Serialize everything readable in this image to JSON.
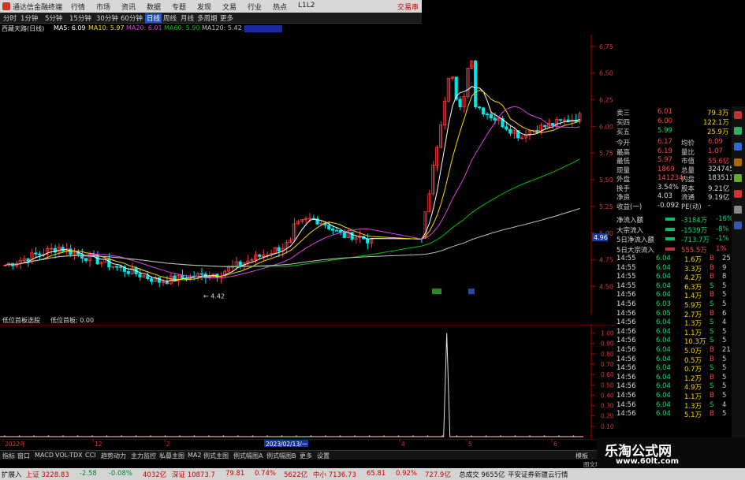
{
  "titlebar": {
    "app_title": "通达信金融终端",
    "menus": [
      "行情",
      "市场",
      "资讯",
      "数据",
      "专题",
      "发现",
      "文易",
      "行业",
      "热点",
      "L1L2"
    ],
    "trade_label": "交易串"
  },
  "timeframes": [
    "分时",
    "1分钟",
    "5分钟",
    "15分钟",
    "30分钟",
    "60分钟",
    "日线",
    "周线",
    "月线",
    "多周期",
    "更多"
  ],
  "ma_line": {
    "stock": "西藏天路(日线)",
    "ma5": "MA5: 6.09",
    "ma10": "MA10: 5.97",
    "ma20": "MA20: 6.01",
    "ma60": "MA60: 5.90",
    "ma120": "MA120: 5.42"
  },
  "indicator_header": {
    "name": "低位首板选股",
    "series": "低位首板: 0.00"
  },
  "chart_data": {
    "type": "line",
    "main_price_axis": [
      "6.75",
      "6.50",
      "6.25",
      "6.00",
      "5.75",
      "5.50",
      "5.25",
      "5.00",
      "4.75",
      "4.50"
    ],
    "current_price_tag": "4.96",
    "low_label": "4.42",
    "indicator_axis": [
      "1.00",
      "0.90",
      "0.80",
      "0.70",
      "0.60",
      "0.50",
      "0.40",
      "0.30",
      "0.20",
      "0.10"
    ],
    "indicator_series": {
      "name": "低位首板",
      "spike_value": 1.0
    },
    "x_labels": [
      "2022年",
      "12",
      "2",
      "4",
      "5",
      "6"
    ],
    "date_tag": "2023/02/13/一"
  },
  "quote_panel": {
    "order_book": [
      {
        "label": "卖三",
        "price": "6.01",
        "vol": "79.3万"
      },
      {
        "label": "买四",
        "price": "6.00",
        "vol": "122.1万"
      },
      {
        "label": "买五",
        "price": "5.99",
        "vol": "25.9万"
      }
    ],
    "stats": [
      {
        "a": "今开",
        "b": "6.17",
        "c": "均价",
        "d": "6.09"
      },
      {
        "a": "最高",
        "b": "6.19",
        "c": "量比",
        "d": "1.07"
      },
      {
        "a": "最低",
        "b": "5.97",
        "c": "市值",
        "d": "55.6亿"
      },
      {
        "a": "现量",
        "b": "1869",
        "c": "总量",
        "d": "324745"
      },
      {
        "a": "外盘",
        "b": "141234",
        "c": "内盘",
        "d": "183511"
      },
      {
        "a": "换手",
        "b": "3.54%",
        "c": "股本",
        "d": "9.21亿"
      },
      {
        "a": "净资",
        "b": "4.03",
        "c": "流通",
        "d": "9.19亿"
      },
      {
        "a": "收益(一)",
        "b": "-0.092",
        "c": "PE(动)",
        "d": "-"
      }
    ],
    "flows": [
      {
        "label": "净流入额",
        "val": "-3184万",
        "pct": "-16%"
      },
      {
        "label": "大宗流入",
        "val": "-1539万",
        "pct": "-8%"
      },
      {
        "label": "5日净流入额",
        "val": "-713.7万",
        "pct": "-1%"
      },
      {
        "label": "5日大宗流入",
        "val": "555.5万",
        "pct": "1%"
      }
    ],
    "ticks": [
      {
        "t": "14:55",
        "p": "6.04",
        "v": "1.6万",
        "d": "B",
        "n": "25"
      },
      {
        "t": "14:55",
        "p": "6.04",
        "v": "3.3万",
        "d": "B",
        "n": "9"
      },
      {
        "t": "14:55",
        "p": "6.04",
        "v": "4.2万",
        "d": "B",
        "n": "8"
      },
      {
        "t": "14:55",
        "p": "6.04",
        "v": "6.3万",
        "d": "S",
        "n": "5"
      },
      {
        "t": "14:56",
        "p": "6.04",
        "v": "1.4万",
        "d": "B",
        "n": "5"
      },
      {
        "t": "14:56",
        "p": "6.03",
        "v": "5.9万",
        "d": "S",
        "n": "5"
      },
      {
        "t": "14:56",
        "p": "6.05",
        "v": "2.7万",
        "d": "B",
        "n": "6"
      },
      {
        "t": "14:56",
        "p": "6.04",
        "v": "1.3万",
        "d": "S",
        "n": "4"
      },
      {
        "t": "14:56",
        "p": "6.04",
        "v": "1.1万",
        "d": "S",
        "n": "5"
      },
      {
        "t": "14:56",
        "p": "6.04",
        "v": "10.3万",
        "d": "S",
        "n": "5"
      },
      {
        "t": "14:56",
        "p": "6.04",
        "v": "5.0万",
        "d": "B",
        "n": "21"
      },
      {
        "t": "14:56",
        "p": "6.04",
        "v": "0.5万",
        "d": "B",
        "n": "5"
      },
      {
        "t": "14:56",
        "p": "6.04",
        "v": "0.7万",
        "d": "S",
        "n": "5"
      },
      {
        "t": "14:56",
        "p": "6.04",
        "v": "1.2万",
        "d": "B",
        "n": "5"
      },
      {
        "t": "14:56",
        "p": "6.04",
        "v": "4.9万",
        "d": "S",
        "n": "5"
      },
      {
        "t": "14:56",
        "p": "6.04",
        "v": "1.1万",
        "d": "B",
        "n": "5"
      },
      {
        "t": "14:56",
        "p": "6.04",
        "v": "1.3万",
        "d": "S",
        "n": "4"
      },
      {
        "t": "14:56",
        "p": "6.04",
        "v": "5.1万",
        "d": "B",
        "n": "5"
      }
    ]
  },
  "bottom_tabs": [
    "指标",
    "窗口",
    "MACD",
    "VOL-TDX",
    "CCI",
    "趋势动力",
    "主力监控",
    "私募主图",
    "MA2",
    "例式主图",
    "例式幅图A",
    "例式幅图B",
    "更多",
    "设置"
  ],
  "bottom_right_label": "模板",
  "bottom_right_small": "图文F10",
  "statusbar": {
    "items": [
      {
        "label": "扩展入",
        "val": ""
      },
      {
        "label": "上证",
        "val": "3228.83"
      },
      {
        "label": "",
        "val": "-2.58"
      },
      {
        "label": "",
        "val": "-0.08%"
      },
      {
        "label": "",
        "val": "4032亿"
      },
      {
        "label": "深证",
        "val": "10873.7"
      },
      {
        "label": "",
        "val": "79.81"
      },
      {
        "label": "",
        "val": "0.74%"
      },
      {
        "label": "",
        "val": "5622亿"
      },
      {
        "label": "中小",
        "val": "7136.73"
      },
      {
        "label": "",
        "val": "65.81"
      },
      {
        "label": "",
        "val": "0.92%"
      },
      {
        "label": "",
        "val": "727.9亿"
      },
      {
        "label": "总成交",
        "val": "9655亿"
      },
      {
        "label": "平安证券新疆云行情",
        "val": ""
      }
    ]
  },
  "watermark": {
    "line1": "乐淘公式网",
    "line2": "www.60lt.com"
  },
  "colors": {
    "up": "#ff3b3b",
    "down": "#00e5e5",
    "ma5": "#ffffff",
    "ma10": "#ffd700",
    "ma20": "#e040e0",
    "ma60": "#00c000",
    "ma120": "#c0c0c0"
  }
}
